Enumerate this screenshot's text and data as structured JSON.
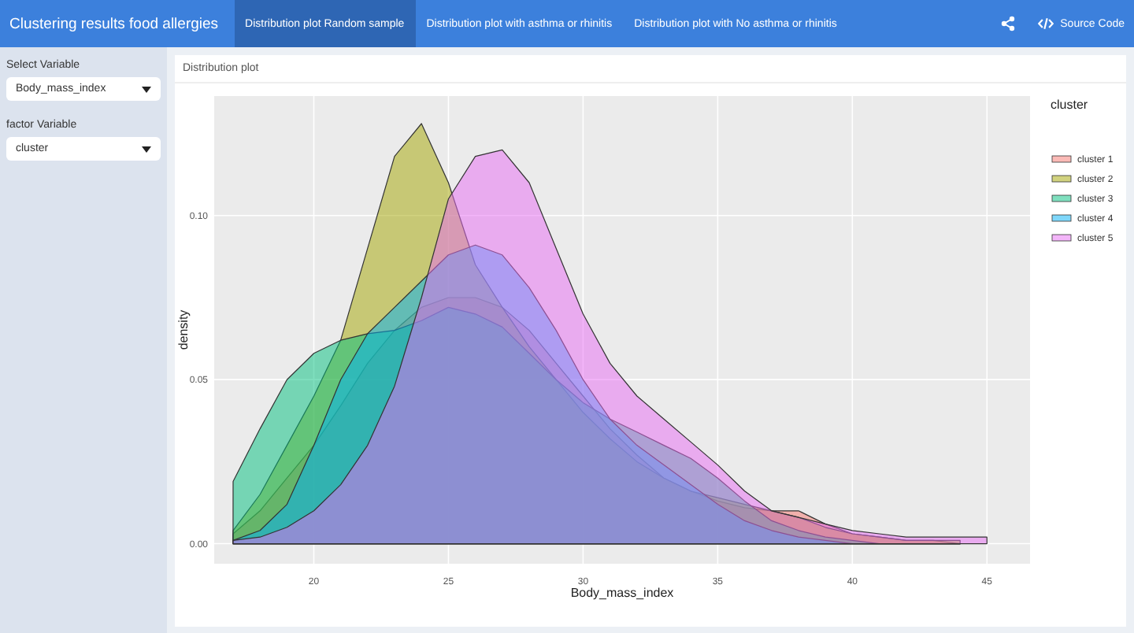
{
  "navbar": {
    "title": "Clustering results food allergies",
    "tabs": [
      {
        "label": "Distribution plot Random sample",
        "selected": true
      },
      {
        "label": "Distribution plot with asthma or rhinitis",
        "selected": false
      },
      {
        "label": "Distribution plot with No asthma or rhinitis",
        "selected": false
      }
    ],
    "source_code": "Source Code"
  },
  "sidebar": {
    "inputs": [
      {
        "label": "Select Variable",
        "value": "Body_mass_index"
      },
      {
        "label": "factor Variable",
        "value": "cluster"
      }
    ]
  },
  "card": {
    "title": "Distribution plot",
    "chart_data": {
      "type": "area",
      "grid": true,
      "legend": true,
      "xlabel": "Body_mass_index",
      "ylabel": "density",
      "legend_title": "cluster",
      "x": [
        17,
        18,
        19,
        20,
        21,
        22,
        23,
        24,
        25,
        26,
        27,
        28,
        29,
        30,
        31,
        32,
        33,
        34,
        35,
        36,
        37,
        38,
        39,
        40,
        41,
        42,
        43,
        44,
        45
      ],
      "xlim": [
        16.3,
        46.6
      ],
      "ylim": [
        -0.0061,
        0.1364
      ],
      "xticks": [
        20,
        25,
        30,
        35,
        40,
        45
      ],
      "yticks": [
        {
          "value": 0,
          "label": "0.00"
        },
        {
          "value": 0.05,
          "label": "0.05"
        },
        {
          "value": 0.1,
          "label": "0.10"
        }
      ],
      "series": [
        {
          "name": "cluster 1",
          "color": "#f8766d",
          "values": [
            0.003,
            0.01,
            0.02,
            0.03,
            0.042,
            0.055,
            0.065,
            0.072,
            0.075,
            0.075,
            0.072,
            0.065,
            0.055,
            0.045,
            0.035,
            0.027,
            0.02,
            0.016,
            0.013,
            0.011,
            0.01,
            0.01,
            0.006,
            0.003,
            0.002,
            0.001,
            0.001,
            0.0,
            null
          ]
        },
        {
          "name": "cluster 2",
          "color": "#a3a500",
          "values": [
            0.004,
            0.015,
            0.03,
            0.045,
            0.062,
            0.09,
            0.118,
            0.128,
            0.11,
            0.085,
            0.072,
            0.06,
            0.05,
            0.04,
            0.032,
            0.025,
            0.02,
            0.016,
            0.014,
            0.012,
            0.01,
            0.008,
            0.005,
            0.003,
            0.002,
            0.001,
            0.001,
            0.001,
            null
          ]
        },
        {
          "name": "cluster 3",
          "color": "#00bf7d",
          "values": [
            0.019,
            0.035,
            0.05,
            0.058,
            0.062,
            0.064,
            0.065,
            0.068,
            0.072,
            0.07,
            0.066,
            0.058,
            0.05,
            0.043,
            0.038,
            0.034,
            0.03,
            0.026,
            0.02,
            0.013,
            0.007,
            0.004,
            0.002,
            0.001,
            0.0,
            0.0,
            0.0,
            0.0,
            null
          ]
        },
        {
          "name": "cluster 4",
          "color": "#00b0f6",
          "values": [
            0.001,
            0.004,
            0.012,
            0.03,
            0.05,
            0.064,
            0.072,
            0.08,
            0.088,
            0.091,
            0.088,
            0.078,
            0.065,
            0.05,
            0.038,
            0.03,
            0.024,
            0.018,
            0.012,
            0.007,
            0.004,
            0.002,
            0.001,
            0.0,
            0.0,
            0.0,
            0.0,
            0.0,
            null
          ]
        },
        {
          "name": "cluster 5",
          "color": "#e76bf3",
          "values": [
            0.001,
            0.002,
            0.005,
            0.01,
            0.018,
            0.03,
            0.048,
            0.075,
            0.105,
            0.118,
            0.12,
            0.11,
            0.09,
            0.07,
            0.055,
            0.045,
            0.038,
            0.031,
            0.024,
            0.016,
            0.01,
            0.008,
            0.006,
            0.004,
            0.003,
            0.002,
            0.002,
            0.002,
            0.002
          ]
        }
      ]
    }
  }
}
